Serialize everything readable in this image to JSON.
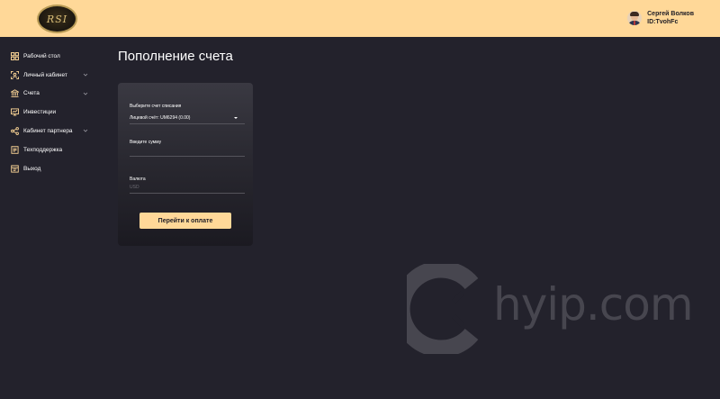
{
  "header": {
    "logo_text": "RSI",
    "user_name": "Сергей Волков",
    "user_id": "ID:TvohFc"
  },
  "sidebar": {
    "items": [
      {
        "label": "Рабочий стол",
        "icon": "grid-icon",
        "has_chevron": false
      },
      {
        "label": "Личный кабинет",
        "icon": "person-frame-icon",
        "has_chevron": true
      },
      {
        "label": "Счета",
        "icon": "bank-icon",
        "has_chevron": true
      },
      {
        "label": "Инвестиции",
        "icon": "monitor-chart-icon",
        "has_chevron": false
      },
      {
        "label": "Кабинет партнера",
        "icon": "network-icon",
        "has_chevron": true
      },
      {
        "label": "Техподдержка",
        "icon": "document-icon",
        "has_chevron": false
      },
      {
        "label": "Выход",
        "icon": "exit-icon",
        "has_chevron": false
      }
    ]
  },
  "main": {
    "title": "Пополнение счета",
    "form": {
      "account_label": "Выберите счет списания",
      "account_value": "Лицевой счёт: UM6294 (0.00)",
      "amount_label": "Введите сумму",
      "amount_value": "",
      "currency_label": "Валюта",
      "currency_value": "USD",
      "submit_label": "Перейти к оплате"
    }
  },
  "watermark": {
    "text": "hyip.com"
  },
  "colors": {
    "accent": "#ffd898",
    "background": "#23222c",
    "icon": "#ffd898"
  }
}
